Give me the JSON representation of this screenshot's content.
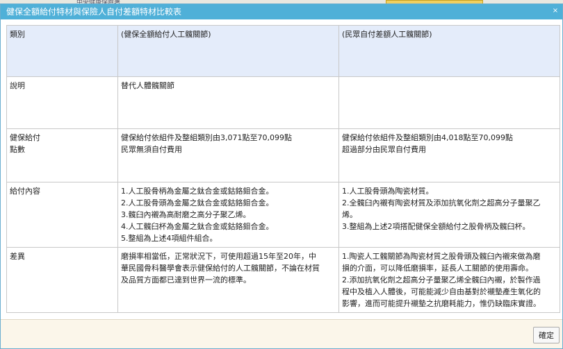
{
  "background": {
    "site_name": "中央健康保險署"
  },
  "dialog": {
    "title": "健保全額給付特材與保險人自付差額特材比較表",
    "close_label": "×",
    "ok_label": "確定"
  },
  "table": {
    "header": {
      "label": "類別",
      "col1": "(健保全額給付人工髖關節)",
      "col2": "(民眾自付差額人工髖關節)"
    },
    "rows": [
      {
        "label_lines": [
          "說明"
        ],
        "col1_lines": [
          "替代人體髖關節"
        ],
        "col2_lines": []
      },
      {
        "label_lines": [
          "健保給付",
          "點數"
        ],
        "col1_lines": [
          "健保給付依組件及整組類別由3,071點至70,099點",
          "民眾無須自付費用"
        ],
        "col2_lines": [
          "健保給付依組件及整組類別由4,018點至70,099點",
          "超過部分由民眾自付費用"
        ]
      },
      {
        "label_lines": [
          "給付內容"
        ],
        "col1_lines": [
          "1.人工股骨柄為金屬之鈦合金或鈷鉻鉬合金。",
          "2.人工股骨頭為金屬之鈦合金或鈷鉻鉬合金。",
          "3.髖臼內襯為高耐磨之高分子聚乙烯。",
          "4.人工髖臼杯為金屬之鈦合金或鈷鉻鉬合金。",
          "5.整組為上述4項組件組合。"
        ],
        "col2_lines": [
          "1.人工股骨頭為陶瓷材質。",
          "2.全髖臼內襯有陶瓷材質及添加抗氧化劑之超高分子量聚乙",
          "烯。",
          "3.整組為上述2項搭配健保全額給付之股骨柄及髖臼杯。"
        ]
      },
      {
        "label_lines": [
          "差異"
        ],
        "col1_lines": [
          "磨損率相當低，正常狀況下，可使用超過15年至20年，中",
          "華民國骨科醫學會表示健保給付的人工髖關節，不論在材質",
          "及品質方面都已達到世界一流的標準。"
        ],
        "col2_lines": [
          "1.陶瓷人工髖關節為陶瓷材質之股骨頭及髖臼內襯來做為磨",
          "損的介面，可以降低磨損率，延長人工關節的使用壽命。",
          "2.添加抗氧化劑之超高分子量聚乙烯全髖臼內襯，於製作過",
          "程中及植入人體後，可能能減少自由基對於襯墊產生氧化的",
          "影響，進而可能提升襯墊之抗磨耗能力，惟仍缺臨床實證。"
        ]
      }
    ]
  }
}
